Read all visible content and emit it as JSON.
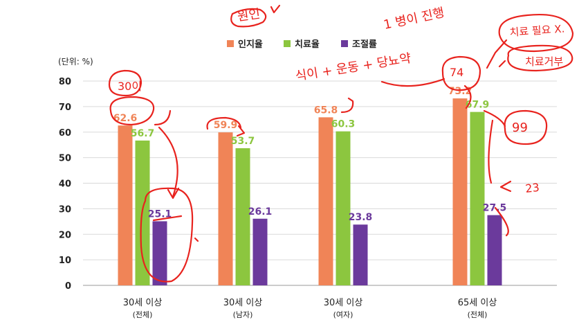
{
  "chart_data": {
    "type": "bar",
    "unit_label": "(단위: %)",
    "categories": [
      {
        "name": "30세 이상",
        "sub": "(전체)"
      },
      {
        "name": "30세 이상",
        "sub": "(남자)"
      },
      {
        "name": "30세 이상",
        "sub": "(여자)"
      },
      {
        "name": "65세 이상",
        "sub": "(전체)"
      }
    ],
    "series": [
      {
        "name": "인지율",
        "color": "#f08457",
        "values": [
          62.6,
          59.9,
          65.8,
          73.2
        ]
      },
      {
        "name": "치료율",
        "color": "#8cc63f",
        "values": [
          56.7,
          53.7,
          60.3,
          67.9
        ]
      },
      {
        "name": "조절률",
        "color": "#6b3a9c",
        "values": [
          25.1,
          26.1,
          23.8,
          27.5
        ]
      }
    ],
    "ylim": [
      0,
      80
    ],
    "yticks": [
      0,
      10,
      20,
      30,
      40,
      50,
      60,
      70,
      80
    ],
    "grid": true,
    "legend_position": "top-center"
  },
  "annotations": {
    "top_note": "원인",
    "step_note": "1 병이 진행",
    "cause_note": "식이 + 운동 + 당뇨약",
    "no_treatment": "치료 필요 X.",
    "refuse_note": "치료거부",
    "age_note": "30이",
    "seventy_four": "74",
    "twenty_three": "23",
    "ratio_note": "99"
  }
}
